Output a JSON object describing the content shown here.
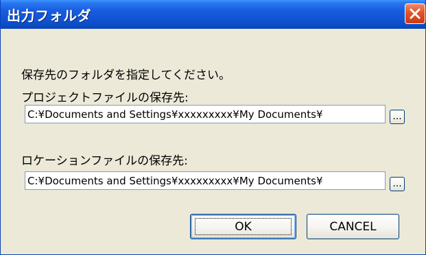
{
  "window": {
    "title": "出力フォルダ"
  },
  "instruction": "保存先のフォルダを指定してください。",
  "project": {
    "label": "プロジェクトファイルの保存先:",
    "path": "C:¥Documents and Settings¥xxxxxxxxx¥My Documents¥",
    "browse_label": "..."
  },
  "location": {
    "label": "ロケーションファイルの保存先:",
    "path": "C:¥Documents and Settings¥xxxxxxxxx¥My Documents¥",
    "browse_label": "..."
  },
  "buttons": {
    "ok": "OK",
    "cancel": "CANCEL"
  },
  "icons": {
    "close": "close-icon"
  },
  "colors": {
    "titlebar": "#1255d8",
    "dialog_bg": "#ece9d8",
    "close_button": "#e0532c",
    "button_border": "#003c74"
  }
}
